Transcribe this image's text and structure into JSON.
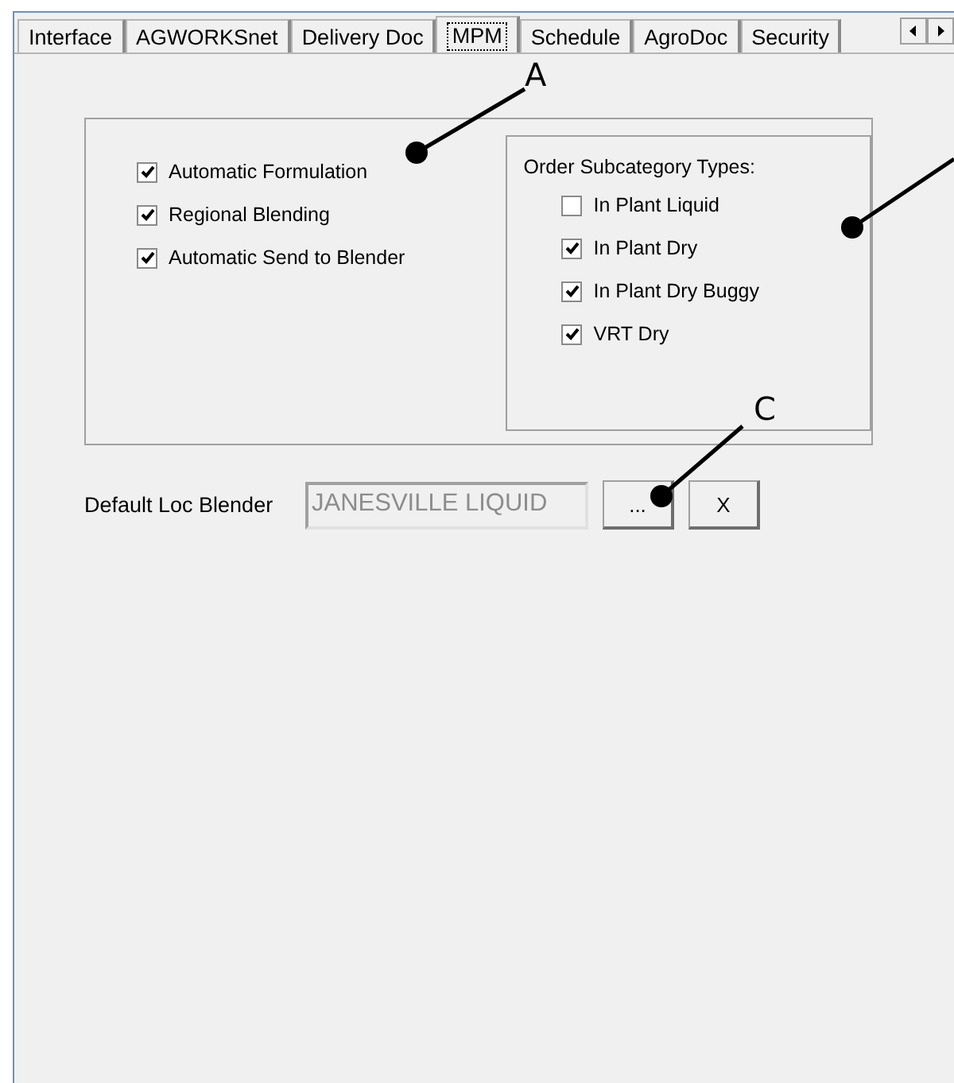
{
  "tabs": [
    {
      "label": "Interface",
      "selected": false
    },
    {
      "label": "AGWORKSnet",
      "selected": false
    },
    {
      "label": "Delivery Doc",
      "selected": false
    },
    {
      "label": "MPM",
      "selected": true
    },
    {
      "label": "Schedule",
      "selected": false
    },
    {
      "label": "AgroDoc",
      "selected": false
    },
    {
      "label": "Security",
      "selected": false
    }
  ],
  "options": [
    {
      "label": "Automatic Formulation",
      "checked": true
    },
    {
      "label": "Regional Blending",
      "checked": true
    },
    {
      "label": "Automatic Send to Blender",
      "checked": true
    }
  ],
  "subcategory_group": {
    "title": "Order Subcategory Types:",
    "items": [
      {
        "label": "In Plant Liquid",
        "checked": false
      },
      {
        "label": "In Plant Dry",
        "checked": true
      },
      {
        "label": "In Plant Dry Buggy",
        "checked": true
      },
      {
        "label": "VRT Dry",
        "checked": true
      }
    ]
  },
  "default_blender": {
    "label": "Default Loc Blender",
    "value": "JANESVILLE LIQUID",
    "disabled": true,
    "browse_button": "...",
    "clear_button": "X"
  },
  "annotations": [
    {
      "kind": "labeled",
      "label": "A"
    },
    {
      "kind": "unlabeled"
    },
    {
      "kind": "labeled",
      "label": "C"
    }
  ]
}
